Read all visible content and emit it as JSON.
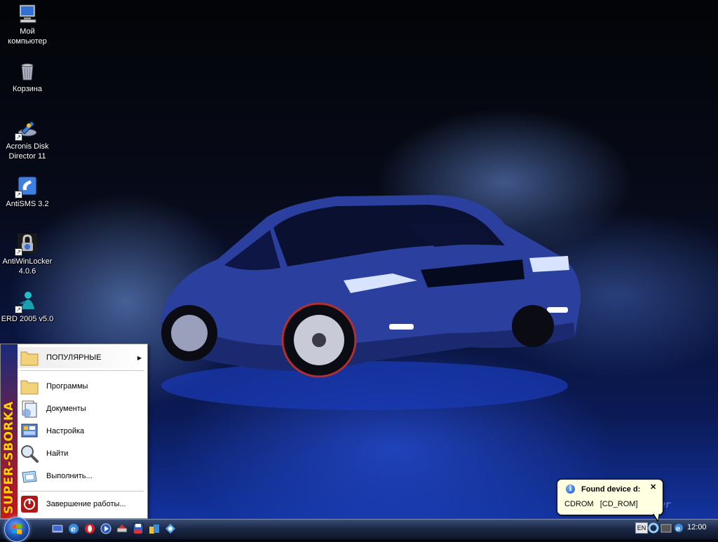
{
  "desktop": {
    "icons": [
      {
        "label": "Мой\nкомпьютер",
        "icon": "my-computer-icon"
      },
      {
        "label": "Корзина",
        "icon": "recycle-bin-icon"
      },
      {
        "label": "Acronis Disk\nDirector 11",
        "icon": "acronis-icon"
      },
      {
        "label": "AntiSMS 3.2",
        "icon": "antisms-icon"
      },
      {
        "label": "AntiWinLocker\n4.0.6",
        "icon": "lock-icon"
      },
      {
        "label": "ERD 2005 v5.0",
        "icon": "erd-icon"
      }
    ]
  },
  "start_menu": {
    "side_banner": "SUPER-SBORKA",
    "items": [
      {
        "label": "ПОПУЛЯРНЫЕ",
        "icon": "folder-icon",
        "has_submenu": true
      },
      {
        "label": "Программы",
        "icon": "folder-icon"
      },
      {
        "label": "Документы",
        "icon": "documents-icon"
      },
      {
        "label": "Настройка",
        "icon": "settings-icon"
      },
      {
        "label": "Найти",
        "icon": "search-icon"
      },
      {
        "label": "Выполнить...",
        "icon": "run-icon"
      },
      {
        "label": "Завершение работы...",
        "icon": "shutdown-icon"
      }
    ],
    "submenu_arrow": "▶"
  },
  "taskbar": {
    "quick_launch": [
      "show-desktop-icon",
      "ie-icon",
      "opera-icon",
      "media-player-icon",
      "network-icon",
      "save-icon",
      "explorer-icon",
      "app-icon"
    ],
    "language": "EN",
    "clock": "12:00"
  },
  "notification": {
    "title": "Found device d:",
    "text": "CDROM   [CD_ROM]",
    "close": "✕",
    "info": "i"
  },
  "colors": {
    "taskbar": "#1c2a48",
    "balloon": "#ffffe1",
    "banner_text": "#ffd400"
  }
}
